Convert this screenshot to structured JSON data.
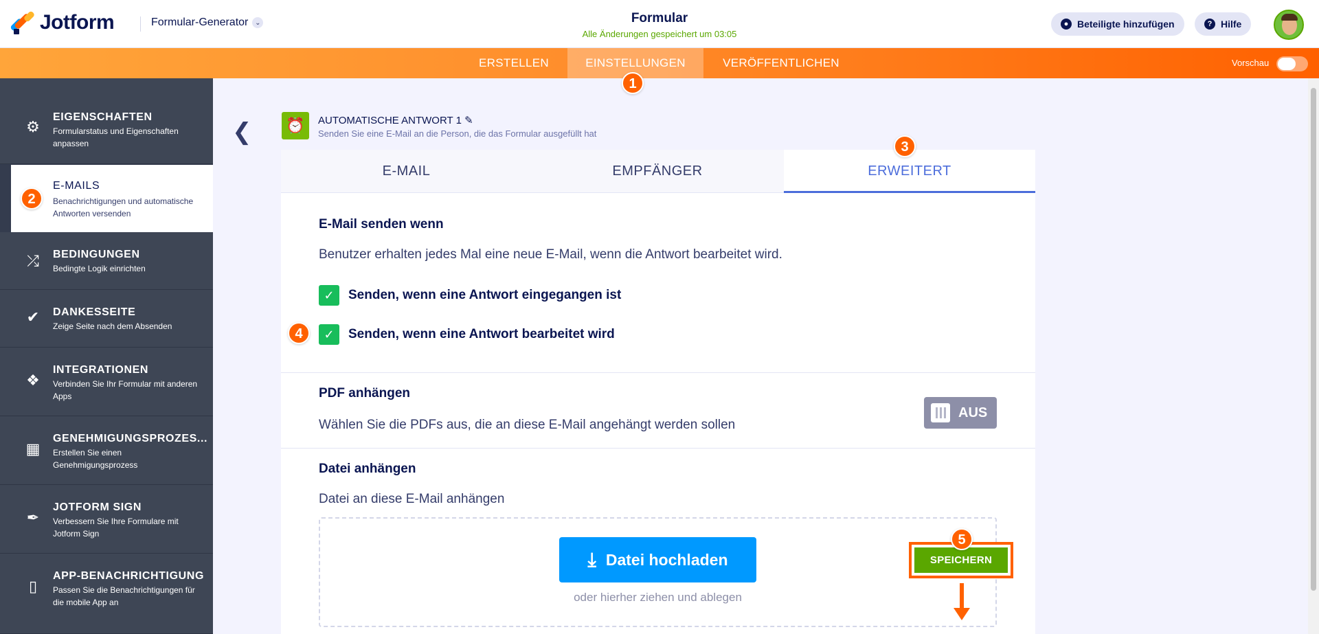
{
  "header": {
    "logo_text": "Jotform",
    "builder_label": "Formular-Generator",
    "form_title": "Formular",
    "saved_status": "Alle Änderungen gespeichert um 03:05",
    "add_participants": "Beteiligte hinzufügen",
    "help": "Hilfe"
  },
  "nav": {
    "tabs": [
      {
        "label": "ERSTELLEN"
      },
      {
        "label": "EINSTELLUNGEN"
      },
      {
        "label": "VERÖFFENTLICHEN"
      }
    ],
    "preview_label": "Vorschau",
    "preview_on": false
  },
  "badges": [
    "1",
    "2",
    "3",
    "4",
    "5"
  ],
  "sidebar": {
    "items": [
      {
        "title": "EIGENSCHAFTEN",
        "desc": "Formularstatus und Eigenschaften anpassen",
        "icon": "gear-icon"
      },
      {
        "title": "E-MAILS",
        "desc": "Benachrichtigungen und automatische Antworten versenden",
        "icon": "envelope-icon"
      },
      {
        "title": "BEDINGUNGEN",
        "desc": "Bedingte Logik einrichten",
        "icon": "shuffle-icon"
      },
      {
        "title": "DANKESSEITE",
        "desc": "Zeige Seite nach dem Absenden",
        "icon": "check-circle-icon"
      },
      {
        "title": "INTEGRATIONEN",
        "desc": "Verbinden Sie Ihr Formular mit anderen Apps",
        "icon": "puzzle-icon"
      },
      {
        "title": "GENEHMIGUNGSPROZES...",
        "desc": "Erstellen Sie einen Genehmigungsprozess",
        "icon": "flow-icon"
      },
      {
        "title": "JOTFORM SIGN",
        "desc": "Verbessern Sie Ihre Formulare mit Jotform Sign",
        "icon": "pen-icon"
      },
      {
        "title": "APP-BENACHRICHTIGUNG",
        "desc": "Passen Sie die Benachrichtigungen für die mobile App an",
        "icon": "mobile-icon"
      }
    ]
  },
  "autoreply": {
    "title": "AUTOMATISCHE ANTWORT 1",
    "subtitle": "Senden Sie eine E-Mail an die Person, die das Formular ausgefüllt hat"
  },
  "tabs": [
    {
      "label": "E-MAIL"
    },
    {
      "label": "EMPFÄNGER"
    },
    {
      "label": "ERWEITERT"
    }
  ],
  "send_when": {
    "title": "E-Mail senden wenn",
    "text": "Benutzer erhalten jedes Mal eine neue E-Mail, wenn die Antwort bearbeitet wird.",
    "option1": "Senden, wenn eine Antwort eingegangen ist",
    "option1_checked": true,
    "option2": "Senden, wenn eine Antwort bearbeitet wird",
    "option2_checked": true
  },
  "pdf": {
    "title": "PDF anhängen",
    "text": "Wählen Sie die PDFs aus, die an diese E-Mail angehängt werden sollen",
    "toggle_label": "AUS"
  },
  "file": {
    "title": "Datei anhängen",
    "text": "Datei an diese E-Mail anhängen",
    "upload_label": "Datei hochladen",
    "drag_text": "oder hierher ziehen und ablegen"
  },
  "save_label": "SPEICHERN",
  "colors": {
    "accent_orange": "#ff6100",
    "active_tab_blue": "#4c6ddb",
    "upload_blue": "#0099ff",
    "save_green": "#5aa700",
    "checkbox_green": "#18bd5b"
  }
}
